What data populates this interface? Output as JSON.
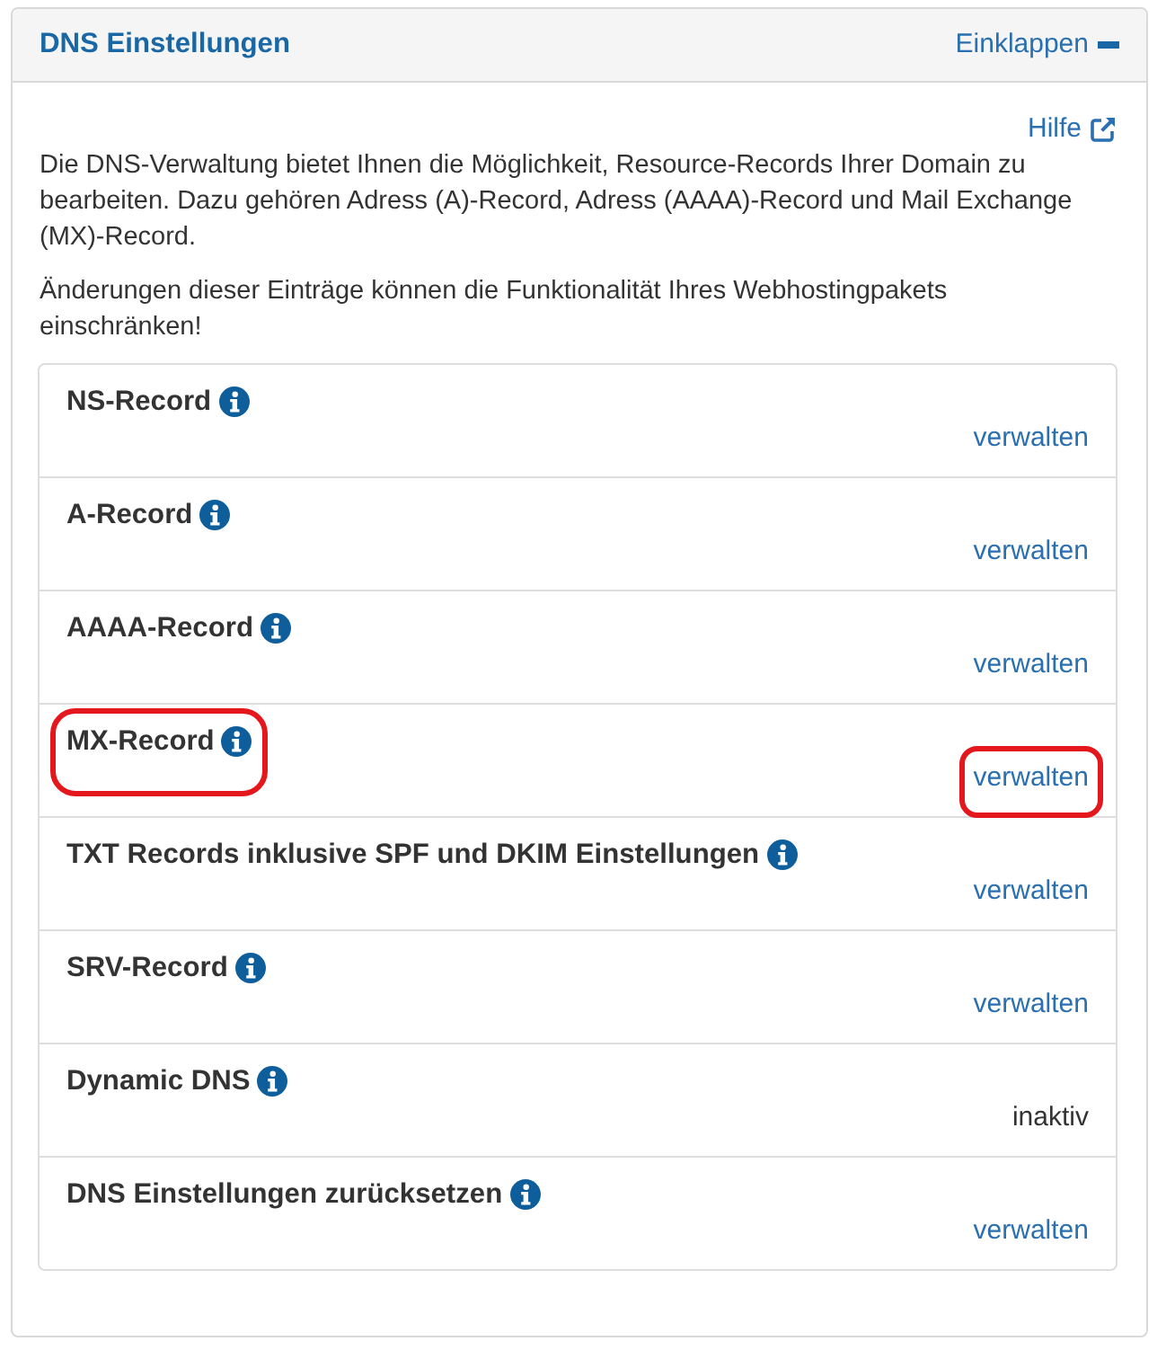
{
  "panel": {
    "title": "DNS Einstellungen",
    "collapse": {
      "label": "Einklappen"
    }
  },
  "help_link": {
    "label": "Hilfe"
  },
  "paragraphs": [
    "Die DNS-Verwaltung bietet Ihnen die Möglichkeit, Resource-Records Ihrer Domain zu bearbeiten. Dazu gehören Adress (A)-Record, Adress (AAAA)-Record und Mail Exchange (MX)-Record.",
    "Änderungen dieser Einträge können die Funktionalität Ihres Webhostingpakets einschränken!"
  ],
  "records": [
    {
      "name": "NS-Record",
      "action": {
        "kind": "link",
        "text": "verwalten"
      },
      "name_circled": false,
      "action_circled": false
    },
    {
      "name": "A-Record",
      "action": {
        "kind": "link",
        "text": "verwalten"
      },
      "name_circled": false,
      "action_circled": false
    },
    {
      "name": "AAAA-Record",
      "action": {
        "kind": "link",
        "text": "verwalten"
      },
      "name_circled": false,
      "action_circled": false
    },
    {
      "name": "MX-Record",
      "action": {
        "kind": "link",
        "text": "verwalten"
      },
      "name_circled": true,
      "action_circled": true
    },
    {
      "name": "TXT Records inklusive SPF und DKIM Einstellungen",
      "action": {
        "kind": "link",
        "text": "verwalten"
      },
      "name_circled": false,
      "action_circled": false
    },
    {
      "name": "SRV-Record",
      "action": {
        "kind": "link",
        "text": "verwalten"
      },
      "name_circled": false,
      "action_circled": false
    },
    {
      "name": "Dynamic DNS",
      "action": {
        "kind": "status",
        "text": "inaktiv"
      },
      "name_circled": false,
      "action_circled": false
    },
    {
      "name": "DNS Einstellungen zurücksetzen",
      "action": {
        "kind": "link",
        "text": "verwalten"
      },
      "name_circled": false,
      "action_circled": false
    }
  ]
}
